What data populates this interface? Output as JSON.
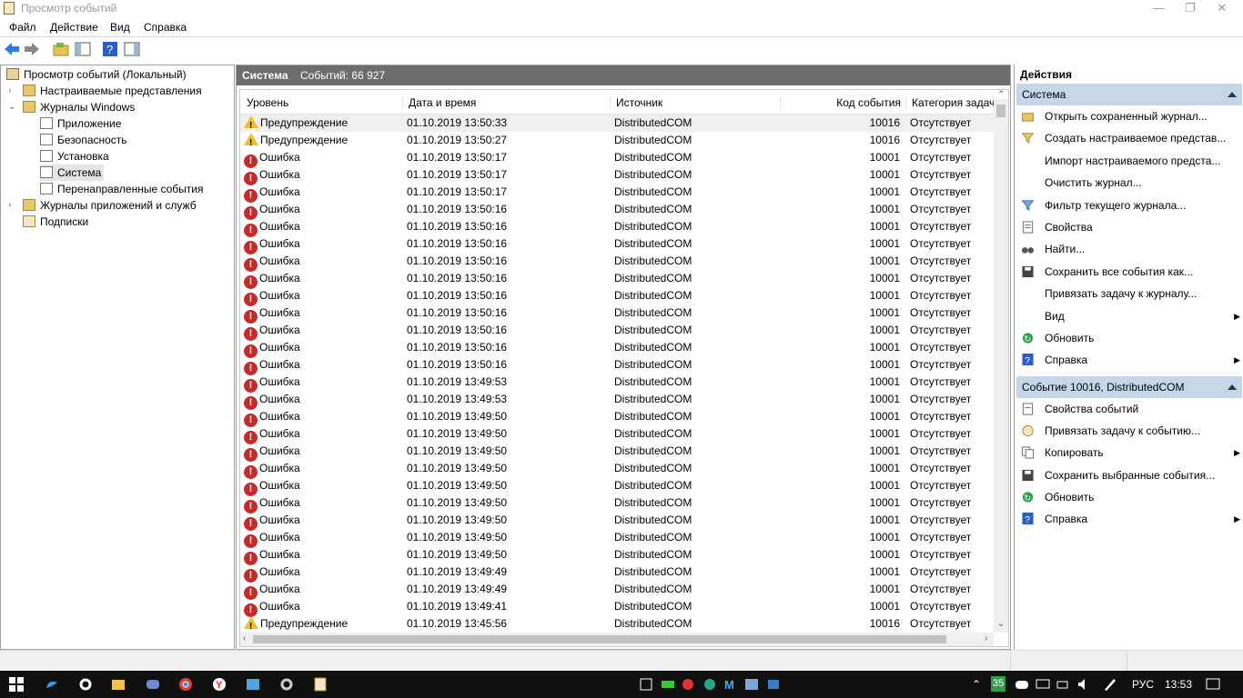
{
  "window": {
    "title": "Просмотр событий",
    "min": "—",
    "max": "❐",
    "close": "✕"
  },
  "menu": {
    "file": "Файл",
    "action": "Действие",
    "view": "Вид",
    "help": "Справка"
  },
  "tree": {
    "root": "Просмотр событий (Локальный)",
    "custom_views": "Настраиваемые представления",
    "windows_logs": "Журналы Windows",
    "application": "Приложение",
    "security": "Безопасность",
    "setup": "Установка",
    "system": "Система",
    "forwarded": "Перенаправленные события",
    "app_service_logs": "Журналы приложений и служб",
    "subscriptions": "Подписки"
  },
  "center": {
    "log_name": "Система",
    "count_label": "Событий: 66 927",
    "columns": {
      "level": "Уровень",
      "datetime": "Дата и время",
      "source": "Источник",
      "event_id": "Код события",
      "category": "Категория задачи"
    },
    "rows": [
      {
        "level": "Предупреждение",
        "type": "warning",
        "datetime": "01.10.2019 13:50:33",
        "source": "DistributedCOM",
        "id": "10016",
        "category": "Отсутствует"
      },
      {
        "level": "Предупреждение",
        "type": "warning",
        "datetime": "01.10.2019 13:50:27",
        "source": "DistributedCOM",
        "id": "10016",
        "category": "Отсутствует"
      },
      {
        "level": "Ошибка",
        "type": "error",
        "datetime": "01.10.2019 13:50:17",
        "source": "DistributedCOM",
        "id": "10001",
        "category": "Отсутствует"
      },
      {
        "level": "Ошибка",
        "type": "error",
        "datetime": "01.10.2019 13:50:17",
        "source": "DistributedCOM",
        "id": "10001",
        "category": "Отсутствует"
      },
      {
        "level": "Ошибка",
        "type": "error",
        "datetime": "01.10.2019 13:50:17",
        "source": "DistributedCOM",
        "id": "10001",
        "category": "Отсутствует"
      },
      {
        "level": "Ошибка",
        "type": "error",
        "datetime": "01.10.2019 13:50:16",
        "source": "DistributedCOM",
        "id": "10001",
        "category": "Отсутствует"
      },
      {
        "level": "Ошибка",
        "type": "error",
        "datetime": "01.10.2019 13:50:16",
        "source": "DistributedCOM",
        "id": "10001",
        "category": "Отсутствует"
      },
      {
        "level": "Ошибка",
        "type": "error",
        "datetime": "01.10.2019 13:50:16",
        "source": "DistributedCOM",
        "id": "10001",
        "category": "Отсутствует"
      },
      {
        "level": "Ошибка",
        "type": "error",
        "datetime": "01.10.2019 13:50:16",
        "source": "DistributedCOM",
        "id": "10001",
        "category": "Отсутствует"
      },
      {
        "level": "Ошибка",
        "type": "error",
        "datetime": "01.10.2019 13:50:16",
        "source": "DistributedCOM",
        "id": "10001",
        "category": "Отсутствует"
      },
      {
        "level": "Ошибка",
        "type": "error",
        "datetime": "01.10.2019 13:50:16",
        "source": "DistributedCOM",
        "id": "10001",
        "category": "Отсутствует"
      },
      {
        "level": "Ошибка",
        "type": "error",
        "datetime": "01.10.2019 13:50:16",
        "source": "DistributedCOM",
        "id": "10001",
        "category": "Отсутствует"
      },
      {
        "level": "Ошибка",
        "type": "error",
        "datetime": "01.10.2019 13:50:16",
        "source": "DistributedCOM",
        "id": "10001",
        "category": "Отсутствует"
      },
      {
        "level": "Ошибка",
        "type": "error",
        "datetime": "01.10.2019 13:50:16",
        "source": "DistributedCOM",
        "id": "10001",
        "category": "Отсутствует"
      },
      {
        "level": "Ошибка",
        "type": "error",
        "datetime": "01.10.2019 13:50:16",
        "source": "DistributedCOM",
        "id": "10001",
        "category": "Отсутствует"
      },
      {
        "level": "Ошибка",
        "type": "error",
        "datetime": "01.10.2019 13:49:53",
        "source": "DistributedCOM",
        "id": "10001",
        "category": "Отсутствует"
      },
      {
        "level": "Ошибка",
        "type": "error",
        "datetime": "01.10.2019 13:49:53",
        "source": "DistributedCOM",
        "id": "10001",
        "category": "Отсутствует"
      },
      {
        "level": "Ошибка",
        "type": "error",
        "datetime": "01.10.2019 13:49:50",
        "source": "DistributedCOM",
        "id": "10001",
        "category": "Отсутствует"
      },
      {
        "level": "Ошибка",
        "type": "error",
        "datetime": "01.10.2019 13:49:50",
        "source": "DistributedCOM",
        "id": "10001",
        "category": "Отсутствует"
      },
      {
        "level": "Ошибка",
        "type": "error",
        "datetime": "01.10.2019 13:49:50",
        "source": "DistributedCOM",
        "id": "10001",
        "category": "Отсутствует"
      },
      {
        "level": "Ошибка",
        "type": "error",
        "datetime": "01.10.2019 13:49:50",
        "source": "DistributedCOM",
        "id": "10001",
        "category": "Отсутствует"
      },
      {
        "level": "Ошибка",
        "type": "error",
        "datetime": "01.10.2019 13:49:50",
        "source": "DistributedCOM",
        "id": "10001",
        "category": "Отсутствует"
      },
      {
        "level": "Ошибка",
        "type": "error",
        "datetime": "01.10.2019 13:49:50",
        "source": "DistributedCOM",
        "id": "10001",
        "category": "Отсутствует"
      },
      {
        "level": "Ошибка",
        "type": "error",
        "datetime": "01.10.2019 13:49:50",
        "source": "DistributedCOM",
        "id": "10001",
        "category": "Отсутствует"
      },
      {
        "level": "Ошибка",
        "type": "error",
        "datetime": "01.10.2019 13:49:50",
        "source": "DistributedCOM",
        "id": "10001",
        "category": "Отсутствует"
      },
      {
        "level": "Ошибка",
        "type": "error",
        "datetime": "01.10.2019 13:49:50",
        "source": "DistributedCOM",
        "id": "10001",
        "category": "Отсутствует"
      },
      {
        "level": "Ошибка",
        "type": "error",
        "datetime": "01.10.2019 13:49:49",
        "source": "DistributedCOM",
        "id": "10001",
        "category": "Отсутствует"
      },
      {
        "level": "Ошибка",
        "type": "error",
        "datetime": "01.10.2019 13:49:49",
        "source": "DistributedCOM",
        "id": "10001",
        "category": "Отсутствует"
      },
      {
        "level": "Ошибка",
        "type": "error",
        "datetime": "01.10.2019 13:49:41",
        "source": "DistributedCOM",
        "id": "10001",
        "category": "Отсутствует"
      },
      {
        "level": "Предупреждение",
        "type": "warning",
        "datetime": "01.10.2019 13:45:56",
        "source": "DistributedCOM",
        "id": "10016",
        "category": "Отсутствует"
      }
    ]
  },
  "actions": {
    "title": "Действия",
    "section1": "Система",
    "items1": [
      {
        "label": "Открыть сохраненный журнал...",
        "icon": "folder-open-icon",
        "sub": false
      },
      {
        "label": "Создать настраиваемое представ...",
        "icon": "filter-create-icon",
        "sub": false
      },
      {
        "label": "Импорт настраиваемого предста...",
        "icon": "",
        "sub": false
      },
      {
        "label": "Очистить журнал...",
        "icon": "",
        "sub": false
      },
      {
        "label": "Фильтр текущего журнала...",
        "icon": "filter-icon",
        "sub": false
      },
      {
        "label": "Свойства",
        "icon": "properties-icon",
        "sub": false
      },
      {
        "label": "Найти...",
        "icon": "binoculars-icon",
        "sub": false
      },
      {
        "label": "Сохранить все события как...",
        "icon": "save-icon",
        "sub": false
      },
      {
        "label": "Привязать задачу к журналу...",
        "icon": "",
        "sub": false
      },
      {
        "label": "Вид",
        "icon": "",
        "sub": true
      },
      {
        "label": "Обновить",
        "icon": "refresh-icon",
        "sub": false
      },
      {
        "label": "Справка",
        "icon": "help-icon",
        "sub": true
      }
    ],
    "section2": "Событие 10016, DistributedCOM",
    "items2": [
      {
        "label": "Свойства событий",
        "icon": "event-properties-icon",
        "sub": false
      },
      {
        "label": "Привязать задачу к событию...",
        "icon": "task-icon",
        "sub": false
      },
      {
        "label": "Копировать",
        "icon": "copy-icon",
        "sub": true
      },
      {
        "label": "Сохранить выбранные события...",
        "icon": "save-icon",
        "sub": false
      },
      {
        "label": "Обновить",
        "icon": "refresh-icon",
        "sub": false
      },
      {
        "label": "Справка",
        "icon": "help-icon",
        "sub": true
      }
    ]
  },
  "taskbar": {
    "lang": "РУС",
    "time": "13:53",
    "badge": "35"
  },
  "colors": {
    "header": "#6d6d6d",
    "section": "#c6d7ea",
    "error": "#c42b2b",
    "warning": "#e8c32a",
    "taskbar": "#101010"
  }
}
